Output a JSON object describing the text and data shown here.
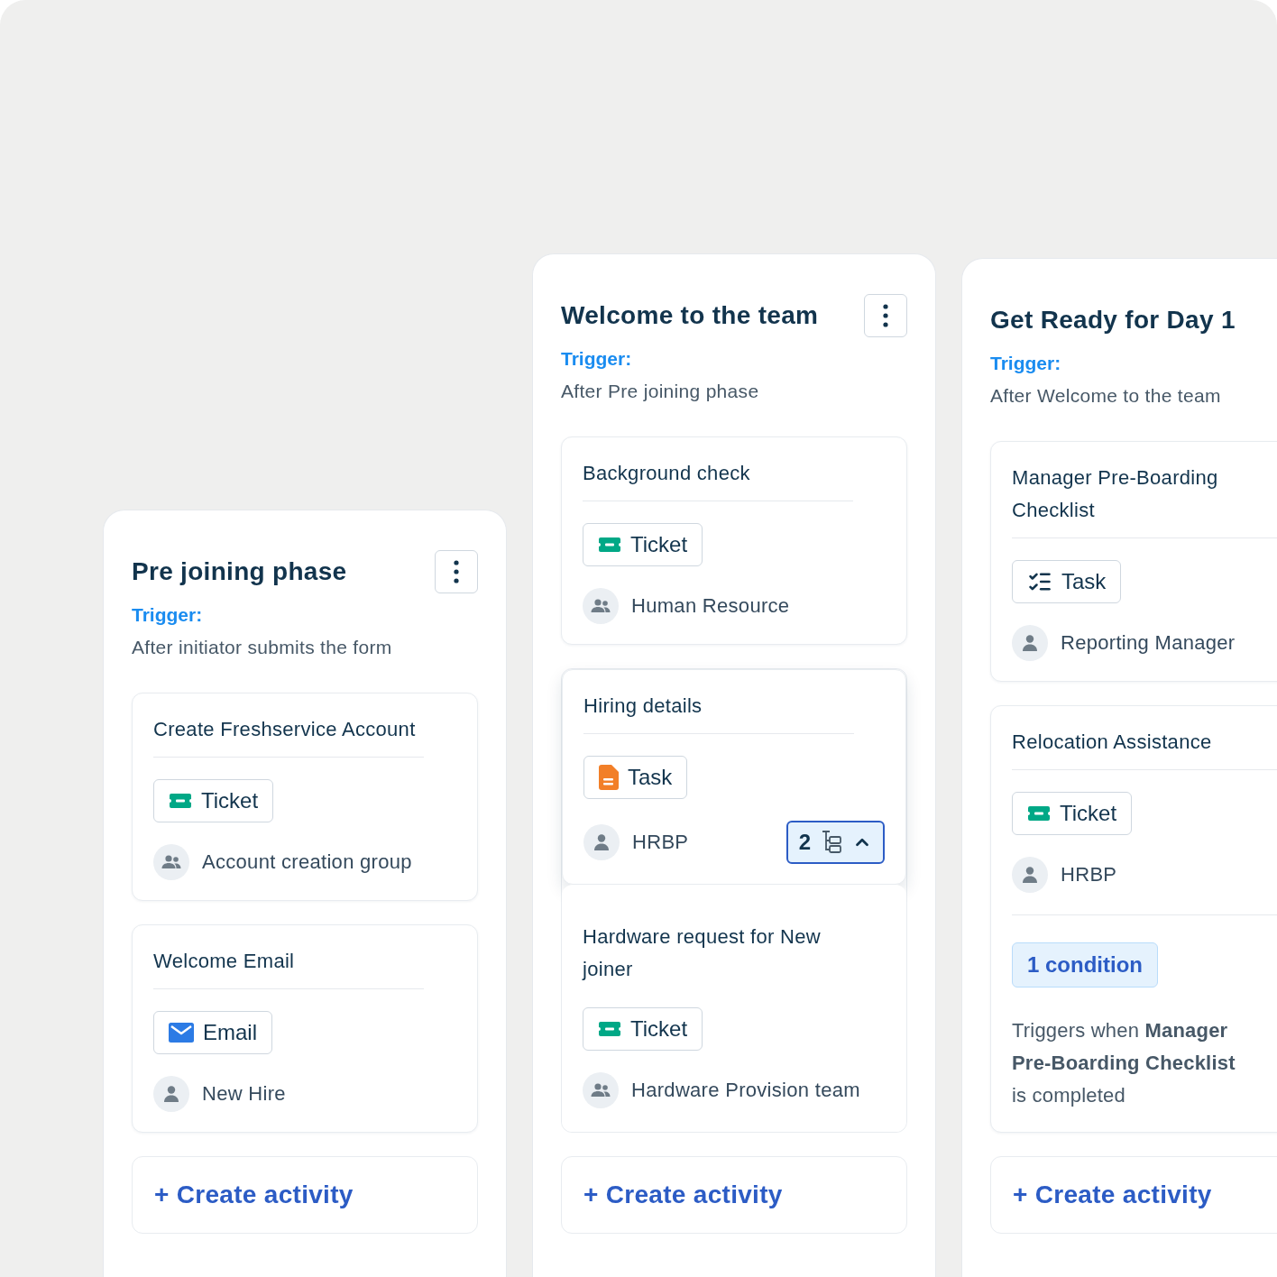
{
  "columns": [
    {
      "title": "Pre joining phase",
      "menu": true,
      "trigger_label": "Trigger:",
      "trigger": "After initiator submits the form",
      "activities": [
        {
          "title": "Create Freshservice Account",
          "tag": {
            "kind": "ticket",
            "label": "Ticket"
          },
          "assignee": {
            "kind": "group",
            "name": "Account creation group"
          }
        },
        {
          "title": "Welcome Email",
          "tag": {
            "kind": "email",
            "label": "Email"
          },
          "assignee": {
            "kind": "person",
            "name": "New Hire"
          }
        }
      ],
      "create_label": "+ Create activity"
    },
    {
      "title": "Welcome to the team",
      "menu": true,
      "trigger_label": "Trigger:",
      "trigger": "After Pre joining phase",
      "activities": [
        {
          "title": "Background check",
          "tag": {
            "kind": "ticket",
            "label": "Ticket"
          },
          "assignee": {
            "kind": "group",
            "name": "Human Resource"
          }
        },
        {
          "title": "Hiring details",
          "tag": {
            "kind": "document",
            "label": "Task"
          },
          "assignee": {
            "kind": "person",
            "name": "HRBP"
          },
          "subtasks": {
            "count": "2",
            "expanded": true
          },
          "children": [
            {
              "title": "Hardware request for New joiner",
              "tag": {
                "kind": "ticket",
                "label": "Ticket"
              },
              "assignee": {
                "kind": "group",
                "name": "Hardware Provision team"
              }
            }
          ]
        }
      ],
      "create_label": "+ Create activity"
    },
    {
      "title": "Get Ready for Day 1",
      "trigger_label": "Trigger:",
      "trigger": "After Welcome to the team",
      "activities": [
        {
          "title": "Manager Pre-Boarding Checklist",
          "tag": {
            "kind": "checklist",
            "label": "Task"
          },
          "assignee": {
            "kind": "person",
            "name": "Reporting Manager"
          }
        },
        {
          "title": "Relocation Assistance",
          "tag": {
            "kind": "ticket",
            "label": "Ticket"
          },
          "assignee": {
            "kind": "person",
            "name": "HRBP"
          },
          "condition": {
            "label": "1 condition",
            "text": "Triggers when **Manager Pre-Boarding Checklist** is completed"
          }
        }
      ],
      "create_label": "+ Create activity"
    }
  ]
}
